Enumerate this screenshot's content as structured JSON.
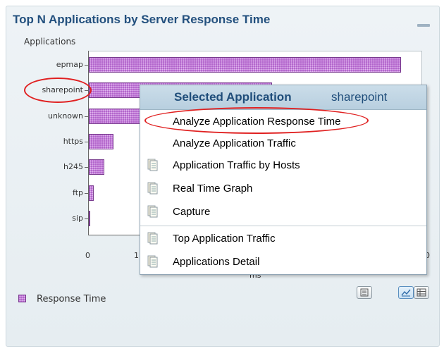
{
  "panel": {
    "title": "Top N Applications by Server Response Time",
    "y_axis_title": "Applications",
    "x_axis_title": "ms",
    "legend_label": "Response Time"
  },
  "chart_data": {
    "type": "bar",
    "orientation": "horizontal",
    "categories": [
      "epmap",
      "sharepoint",
      "unknown",
      "https",
      "h245",
      "ftp",
      "sip"
    ],
    "series": [
      {
        "name": "Response Time",
        "values": [
          1875,
          1100,
          1050,
          148,
          95,
          30,
          4
        ]
      }
    ],
    "xlim": [
      0,
      2000
    ],
    "x_ticks": [
      "0",
      "1",
      "0"
    ],
    "legend": "bottom-left",
    "colors": {
      "bar": "#b366cc",
      "bar_border": "#7a3d8f"
    }
  },
  "context_menu": {
    "header_title": "Selected Application",
    "header_app": "sharepoint",
    "items": [
      {
        "label": "Analyze Application Response Time",
        "icon": ""
      },
      {
        "label": "Analyze Application Traffic",
        "icon": ""
      },
      {
        "label": "Application Traffic by Hosts",
        "icon": "document-icon"
      },
      {
        "label": "Real Time Graph",
        "icon": "document-icon"
      },
      {
        "label": "Capture",
        "icon": "document-icon"
      },
      {
        "label": "Top Application Traffic",
        "icon": "document-icon"
      },
      {
        "label": "Applications Detail",
        "icon": "document-icon"
      }
    ]
  },
  "view_buttons": [
    {
      "icon": "export-icon"
    },
    {
      "icon": "chart-view-icon",
      "active": true
    },
    {
      "icon": "table-view-icon"
    }
  ],
  "colors": {
    "title": "#23507e",
    "highlight_oval": "#e02020",
    "menu_header": "#cbdde9"
  }
}
